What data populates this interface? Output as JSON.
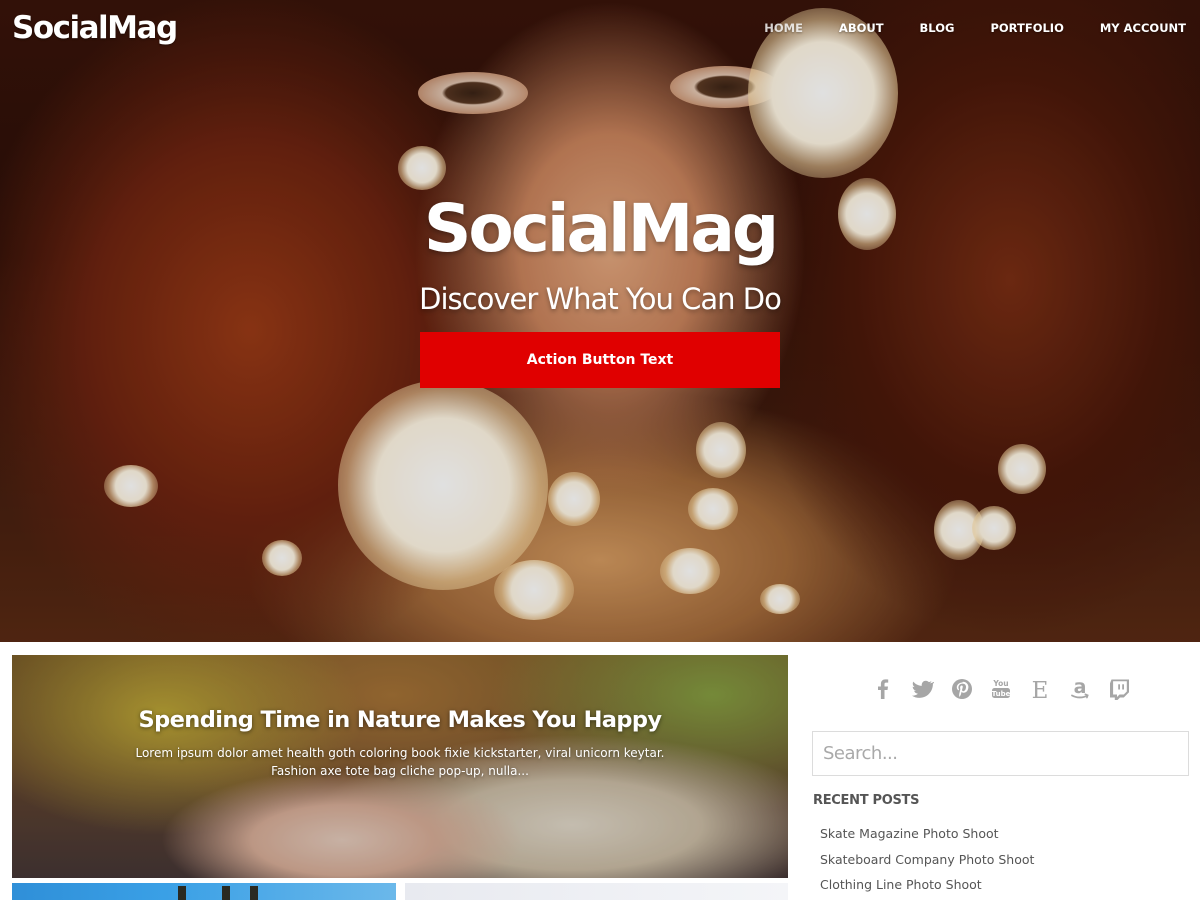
{
  "site": {
    "logo": "SocialMag"
  },
  "nav": {
    "items": [
      {
        "label": "HOME"
      },
      {
        "label": "ABOUT"
      },
      {
        "label": "BLOG"
      },
      {
        "label": "PORTFOLIO"
      },
      {
        "label": "MY ACCOUNT"
      }
    ]
  },
  "hero": {
    "title": "SocialMag",
    "subtitle": "Discover What You Can Do",
    "button_label": "Action Button Text",
    "button_color": "#e00000"
  },
  "featured": {
    "title": "Spending Time in Nature Makes You Happy",
    "excerpt": "Lorem ipsum dolor amet health goth coloring book fixie kickstarter, viral unicorn keytar. Fashion axe tote bag cliche pop-up, nulla..."
  },
  "sidebar": {
    "social_icons": [
      "facebook-icon",
      "twitter-icon",
      "pinterest-icon",
      "youtube-icon",
      "etsy-icon",
      "amazon-icon",
      "twitch-icon"
    ],
    "social_icon_color": "#a6a6a6",
    "search": {
      "placeholder": "Search..."
    },
    "recent_posts": {
      "title": "RECENT POSTS",
      "items": [
        {
          "label": "Skate Magazine Photo Shoot"
        },
        {
          "label": "Skateboard Company Photo Shoot"
        },
        {
          "label": "Clothing Line Photo Shoot"
        }
      ]
    }
  }
}
